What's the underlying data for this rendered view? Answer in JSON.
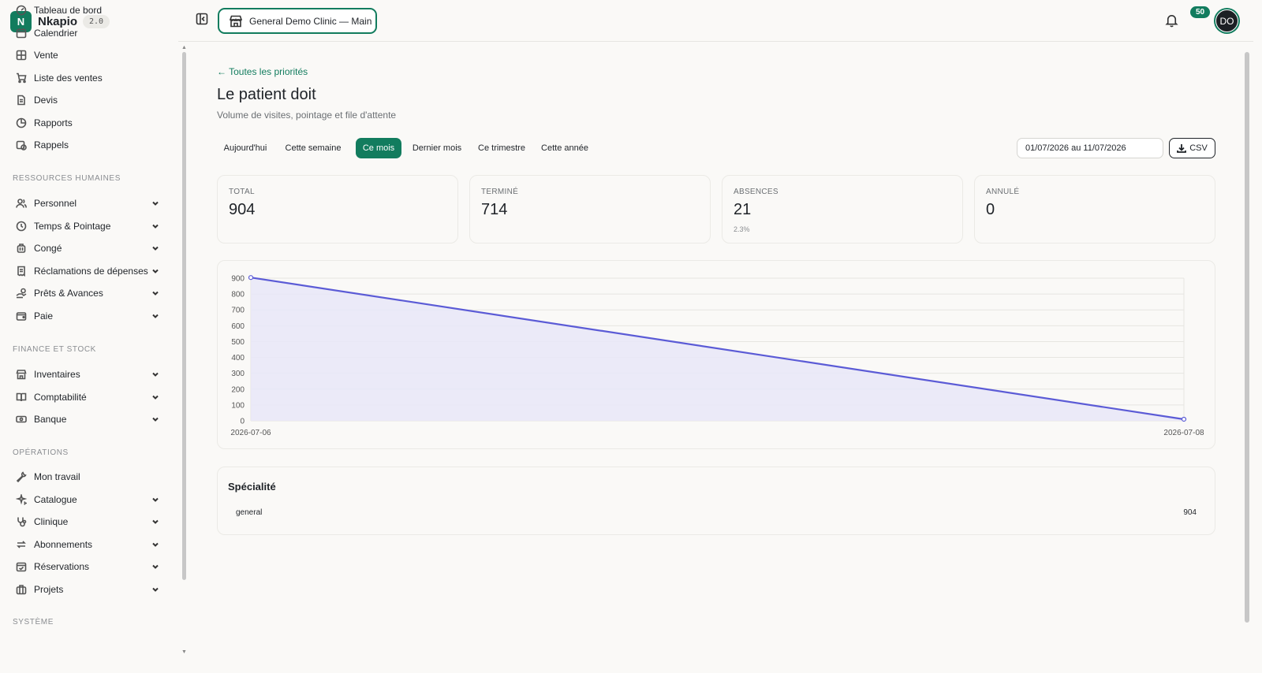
{
  "brand": {
    "logo_letter": "N",
    "name": "Nkapio",
    "version": "2.0"
  },
  "header": {
    "clinic": "General Demo Clinic — Main",
    "notifications": "50",
    "avatar": "DO"
  },
  "sidebar": {
    "items_top": [
      {
        "label": "Tableau de bord",
        "icon": "dashboard-icon"
      },
      {
        "label": "Calendrier",
        "icon": "calendar-icon"
      },
      {
        "label": "Vente",
        "icon": "grid-icon"
      },
      {
        "label": "Liste des ventes",
        "icon": "cart-icon"
      },
      {
        "label": "Devis",
        "icon": "document-icon"
      },
      {
        "label": "Rapports",
        "icon": "pie-chart-icon"
      },
      {
        "label": "Rappels",
        "icon": "calendar-clock-icon"
      }
    ],
    "section_hr": "RESSOURCES HUMAINES",
    "items_hr": [
      {
        "label": "Personnel",
        "icon": "users-icon"
      },
      {
        "label": "Temps & Pointage",
        "icon": "clock-icon"
      },
      {
        "label": "Congé",
        "icon": "luggage-icon"
      },
      {
        "label": "Réclamations de dépenses",
        "icon": "receipt-icon"
      },
      {
        "label": "Prêts & Avances",
        "icon": "hand-coins-icon"
      },
      {
        "label": "Paie",
        "icon": "wallet-icon"
      }
    ],
    "section_fin": "FINANCE ET STOCK",
    "items_fin": [
      {
        "label": "Inventaires",
        "icon": "store-icon"
      },
      {
        "label": "Comptabilité",
        "icon": "book-icon"
      },
      {
        "label": "Banque",
        "icon": "banknote-icon"
      }
    ],
    "section_ops": "OPÉRATIONS",
    "items_ops": [
      {
        "label": "Mon travail",
        "icon": "wrench-icon"
      },
      {
        "label": "Catalogue",
        "icon": "sparkles-icon"
      },
      {
        "label": "Clinique",
        "icon": "stethoscope-icon"
      },
      {
        "label": "Abonnements",
        "icon": "repeat-icon"
      },
      {
        "label": "Réservations",
        "icon": "calendar-check-icon"
      },
      {
        "label": "Projets",
        "icon": "briefcase-icon"
      }
    ],
    "section_sys": "SYSTÈME"
  },
  "main": {
    "back_link": "← Toutes les priorités",
    "title": "Le patient doit",
    "subtitle": "Volume de visites, pointage et file d'attente",
    "tabs": [
      "Aujourd'hui",
      "Cette semaine",
      "Ce mois",
      "Dernier mois",
      "Ce trimestre",
      "Cette année"
    ],
    "active_tab": "Ce mois",
    "date_range": "01/07/2026 au 11/07/2026",
    "csv_label": "CSV",
    "stats": [
      {
        "label": "TOTAL",
        "value": "904",
        "sub": ""
      },
      {
        "label": "TERMINÉ",
        "value": "714",
        "sub": ""
      },
      {
        "label": "ABSENCES",
        "value": "21",
        "sub": "2.3%"
      },
      {
        "label": "ANNULÉ",
        "value": "0",
        "sub": ""
      }
    ],
    "specialty": {
      "title": "Spécialité",
      "rows": [
        {
          "name": "general",
          "value": "904"
        }
      ]
    }
  },
  "colors": {
    "accent": "#127c5e",
    "line": "#5b5bd6",
    "area": "#e8e7f8"
  },
  "chart_data": {
    "type": "area",
    "x": [
      "2026-07-06",
      "2026-07-08"
    ],
    "series": [
      {
        "values": [
          904,
          10
        ]
      }
    ],
    "ylim": [
      0,
      900
    ],
    "yticks": [
      0,
      100,
      200,
      300,
      400,
      500,
      600,
      700,
      800,
      900
    ],
    "grid": true
  }
}
